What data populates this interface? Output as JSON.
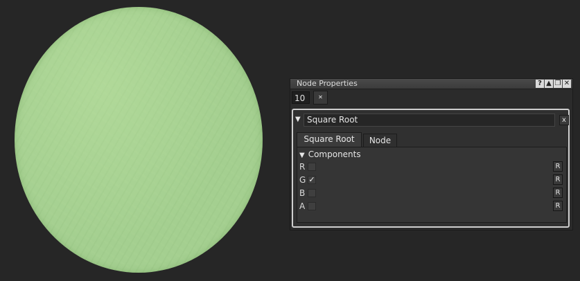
{
  "viewer": {
    "sphere_color": "#a4cf90"
  },
  "panel": {
    "title": "Node Properties",
    "title_icons": [
      "?",
      "▲",
      "❐",
      "✕"
    ],
    "depth_value": "10",
    "clear_icon_glyph": "✕",
    "node": {
      "collapse_glyph": "▼",
      "name": "Square Root",
      "close_glyph": "x",
      "tabs": [
        {
          "label": "Square Root",
          "active": true
        },
        {
          "label": "Node",
          "active": false
        }
      ],
      "section": {
        "glyph": "▼",
        "label": "Components",
        "rows": [
          {
            "label": "R",
            "checked": false,
            "mark": "",
            "reset": "R"
          },
          {
            "label": "G",
            "checked": true,
            "mark": "✓",
            "reset": "R"
          },
          {
            "label": "B",
            "checked": false,
            "mark": "",
            "reset": "R"
          },
          {
            "label": "A",
            "checked": false,
            "mark": "",
            "reset": "R"
          }
        ]
      }
    }
  }
}
